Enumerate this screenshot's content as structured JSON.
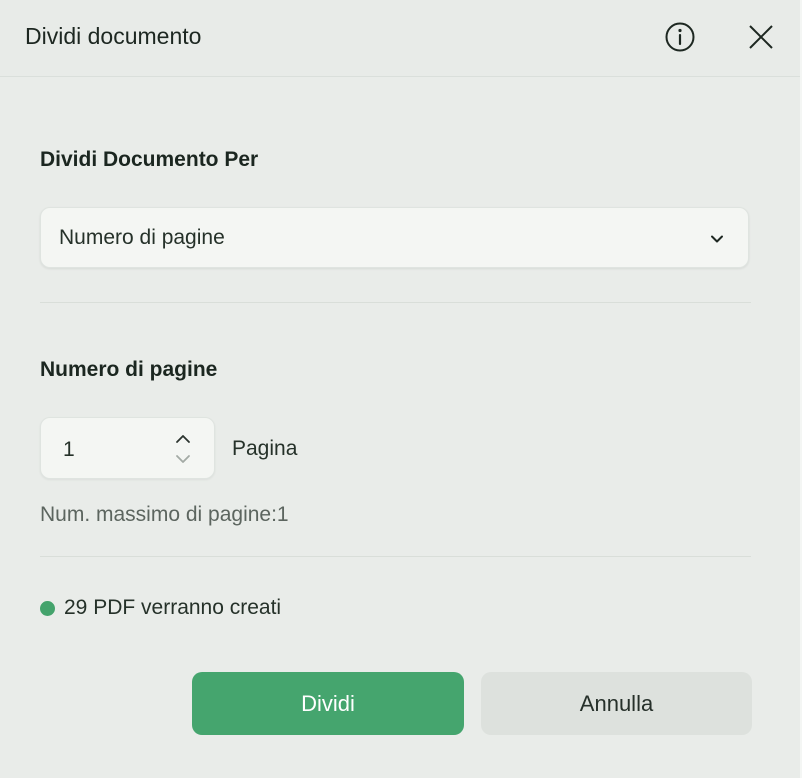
{
  "dialog": {
    "title": "Dividi documento",
    "icons": {
      "info": "info-icon",
      "close": "close-icon"
    }
  },
  "split_by": {
    "label": "Dividi Documento Per",
    "selected": "Numero di pagine"
  },
  "pages": {
    "label": "Numero di pagine",
    "value": "1",
    "unit": "Pagina",
    "max_hint": "Num. massimo di pagine:1"
  },
  "status": {
    "text": "29 PDF verranno creati",
    "color": "#44a36c"
  },
  "buttons": {
    "primary": "Dividi",
    "secondary": "Annulla"
  },
  "colors": {
    "accent": "#45a56e",
    "background": "#e9ece9"
  }
}
